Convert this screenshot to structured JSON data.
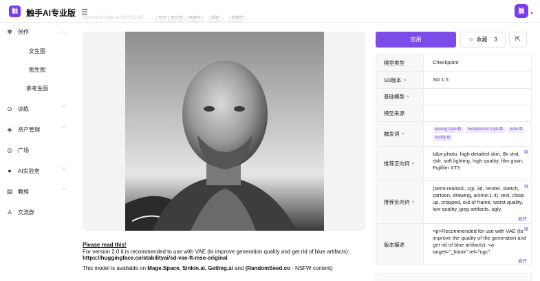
{
  "header": {
    "logo_char": "触",
    "app_title": "触手AI专业版",
    "menu_icon": "menu-fold-icon",
    "avatar_char": "触"
  },
  "sidebar": {
    "items": [
      {
        "label": "创作",
        "icon": "palette-icon",
        "expanded": true
      },
      {
        "label": "训练",
        "icon": "training-icon"
      },
      {
        "label": "资产管理",
        "icon": "layers-icon"
      },
      {
        "label": "广场",
        "icon": "compass-icon"
      },
      {
        "label": "AI实验室",
        "icon": "lab-icon"
      },
      {
        "label": "教程",
        "icon": "book-icon"
      },
      {
        "label": "交流群",
        "icon": "users-icon"
      }
    ],
    "sub_items": [
      "文生图",
      "图生图",
      "参考生图"
    ]
  },
  "breadcrumb": {
    "text": "Epicrealism Natural Sin RC1 VAE",
    "tags": [
      "写实",
      "真实感",
      "高细节",
      "摄影",
      "单模型"
    ]
  },
  "note": {
    "heading": "Please read this!",
    "line1": "For version 2.0 it is recommended to use with VAE (to improve generation quality and get rid of blue artifacts):",
    "link": "https://huggingface.co/stabilityai/sd-vae-ft-mse-original",
    "line2_prefix": "This model is available on",
    "sites": "Mage.Space, Sinkin.ai, GetImg.ai",
    "line2_and": "and",
    "site_last": "(RandomSeed.co",
    "line2_suffix": "- NSFW content)"
  },
  "actions": {
    "apply_label": "应用",
    "favorite_label": "收藏",
    "favorite_count": "3"
  },
  "info": {
    "model_type": {
      "label": "模型类型",
      "value": "Checkpoint"
    },
    "sd_version": {
      "label": "SD版本",
      "value": "SD 1.5"
    },
    "base_model": {
      "label": "基础模型",
      "value": ""
    },
    "model_source": {
      "label": "模型来源",
      "value": ""
    },
    "trigger_words": {
      "label": "触发词",
      "tags": [
        "analog style",
        "modelshoot style",
        "nsfw",
        "nudity"
      ]
    },
    "positive_prompt": {
      "label": "推荐正向词",
      "value": "b&w photo, high detailed skin, 8k uhd, dslr, soft lighting, high quality, film grain, Fujifilm XT3"
    },
    "negative_prompt": {
      "label": "推荐负向词",
      "value": "(semi-realistic, cgi, 3d, render, sketch, cartoon, drawing, anime:1.4), text, close up, cropped, out of frame, worst quality, low quality, jpeg artifacts, ugly,",
      "expand_label": "展开"
    },
    "version_desc": {
      "label": "版本描述",
      "value": "<p>Recommended for use with VAE (to improve the quality of the generation and get rid of blue artifacts): <a target=\"_blank\" rel=\"ugc\"",
      "expand_label": "展开"
    }
  }
}
